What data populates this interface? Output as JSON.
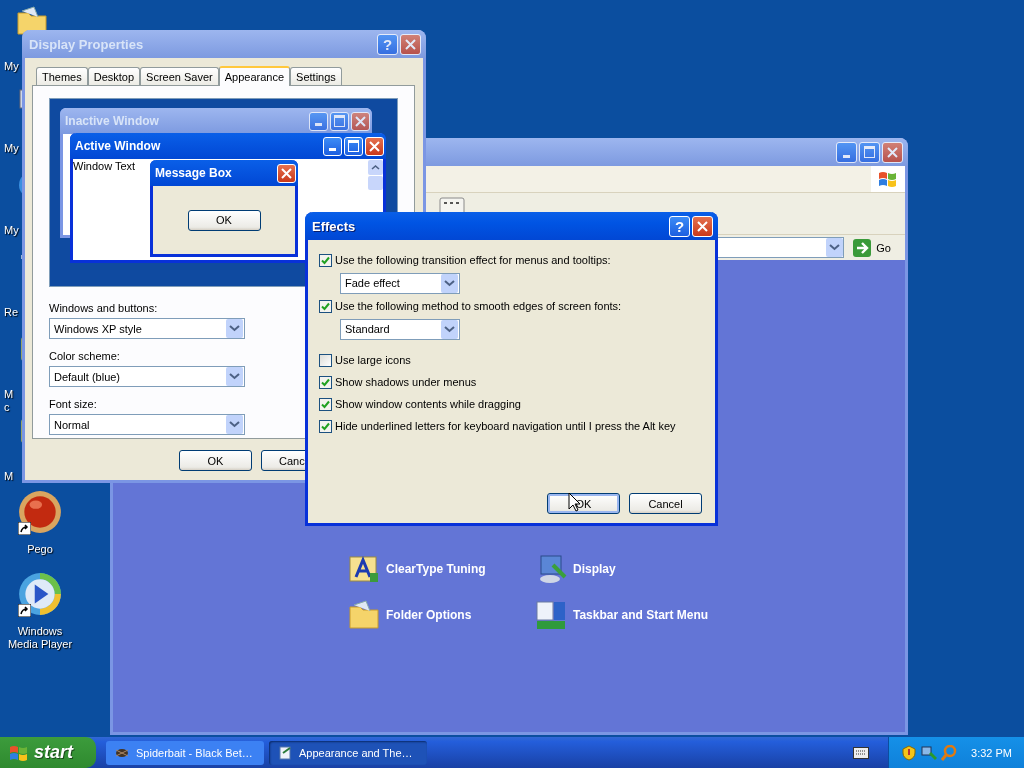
{
  "desktop": {
    "covered_icons": [
      {
        "kind": "folder",
        "label": "My"
      },
      {
        "kind": "computer",
        "label": "My"
      },
      {
        "kind": "globe",
        "label": "My"
      },
      {
        "kind": "recycle",
        "label": "Re"
      },
      {
        "kind": "app",
        "label": "M\nc"
      },
      {
        "kind": "app",
        "label": "M"
      }
    ],
    "icons": [
      {
        "kind": "pego",
        "label": "Pego"
      },
      {
        "kind": "media-player",
        "label": "Windows Media Player"
      }
    ]
  },
  "background_window": {
    "active": false,
    "go_label": "Go",
    "items": [
      {
        "kind": "cleartype",
        "label": "ClearType Tuning"
      },
      {
        "kind": "display",
        "label": "Display"
      },
      {
        "kind": "folder",
        "label": "Folder Options"
      },
      {
        "kind": "taskbar",
        "label": "Taskbar and Start Menu"
      }
    ]
  },
  "display_properties": {
    "title": "Display Properties",
    "active": false,
    "help_label": "?",
    "tabs": [
      {
        "label": "Themes",
        "selected": false
      },
      {
        "label": "Desktop",
        "selected": false
      },
      {
        "label": "Screen Saver",
        "selected": false
      },
      {
        "label": "Appearance",
        "selected": true
      },
      {
        "label": "Settings",
        "selected": false
      }
    ],
    "preview": {
      "inactive_title": "Inactive Window",
      "active_title": "Active Window",
      "window_text": "Window Text",
      "message_title": "Message Box",
      "message_button": "OK"
    },
    "fields": [
      {
        "label": "Windows and buttons:",
        "value": "Windows XP style"
      },
      {
        "label": "Color scheme:",
        "value": "Default (blue)"
      },
      {
        "label": "Font size:",
        "value": "Normal"
      }
    ],
    "buttons": [
      {
        "label": "OK",
        "default": false
      },
      {
        "label": "Canc",
        "default": false
      }
    ]
  },
  "effects": {
    "title": "Effects",
    "active": true,
    "help_label": "?",
    "options": [
      {
        "kind": "checkbox",
        "label": "Use the following transition effect for menus and tooltips:",
        "checked": true
      },
      {
        "kind": "dropdown",
        "value": "Fade effect"
      },
      {
        "kind": "checkbox",
        "label": "Use the following method to smooth edges of screen fonts:",
        "checked": true
      },
      {
        "kind": "dropdown",
        "value": "Standard"
      },
      {
        "kind": "checkbox",
        "label": "Use large icons",
        "checked": false
      },
      {
        "kind": "checkbox",
        "label": "Show shadows under menus",
        "checked": true
      },
      {
        "kind": "checkbox",
        "label": "Show window contents while dragging",
        "checked": true
      },
      {
        "kind": "checkbox",
        "label": "Hide underlined letters for keyboard navigation until I press the Alt key",
        "checked": true
      }
    ],
    "buttons": [
      {
        "label": "OK",
        "default": true
      },
      {
        "label": "Cancel",
        "default": false
      }
    ]
  },
  "taskbar": {
    "start_label": "start",
    "tasks": [
      {
        "kind": "media",
        "label": "Spiderbait - Black Bet…",
        "selected": false
      },
      {
        "kind": "control-panel",
        "label": "Appearance and The…",
        "selected": true
      }
    ],
    "clock": "3:32 PM"
  }
}
